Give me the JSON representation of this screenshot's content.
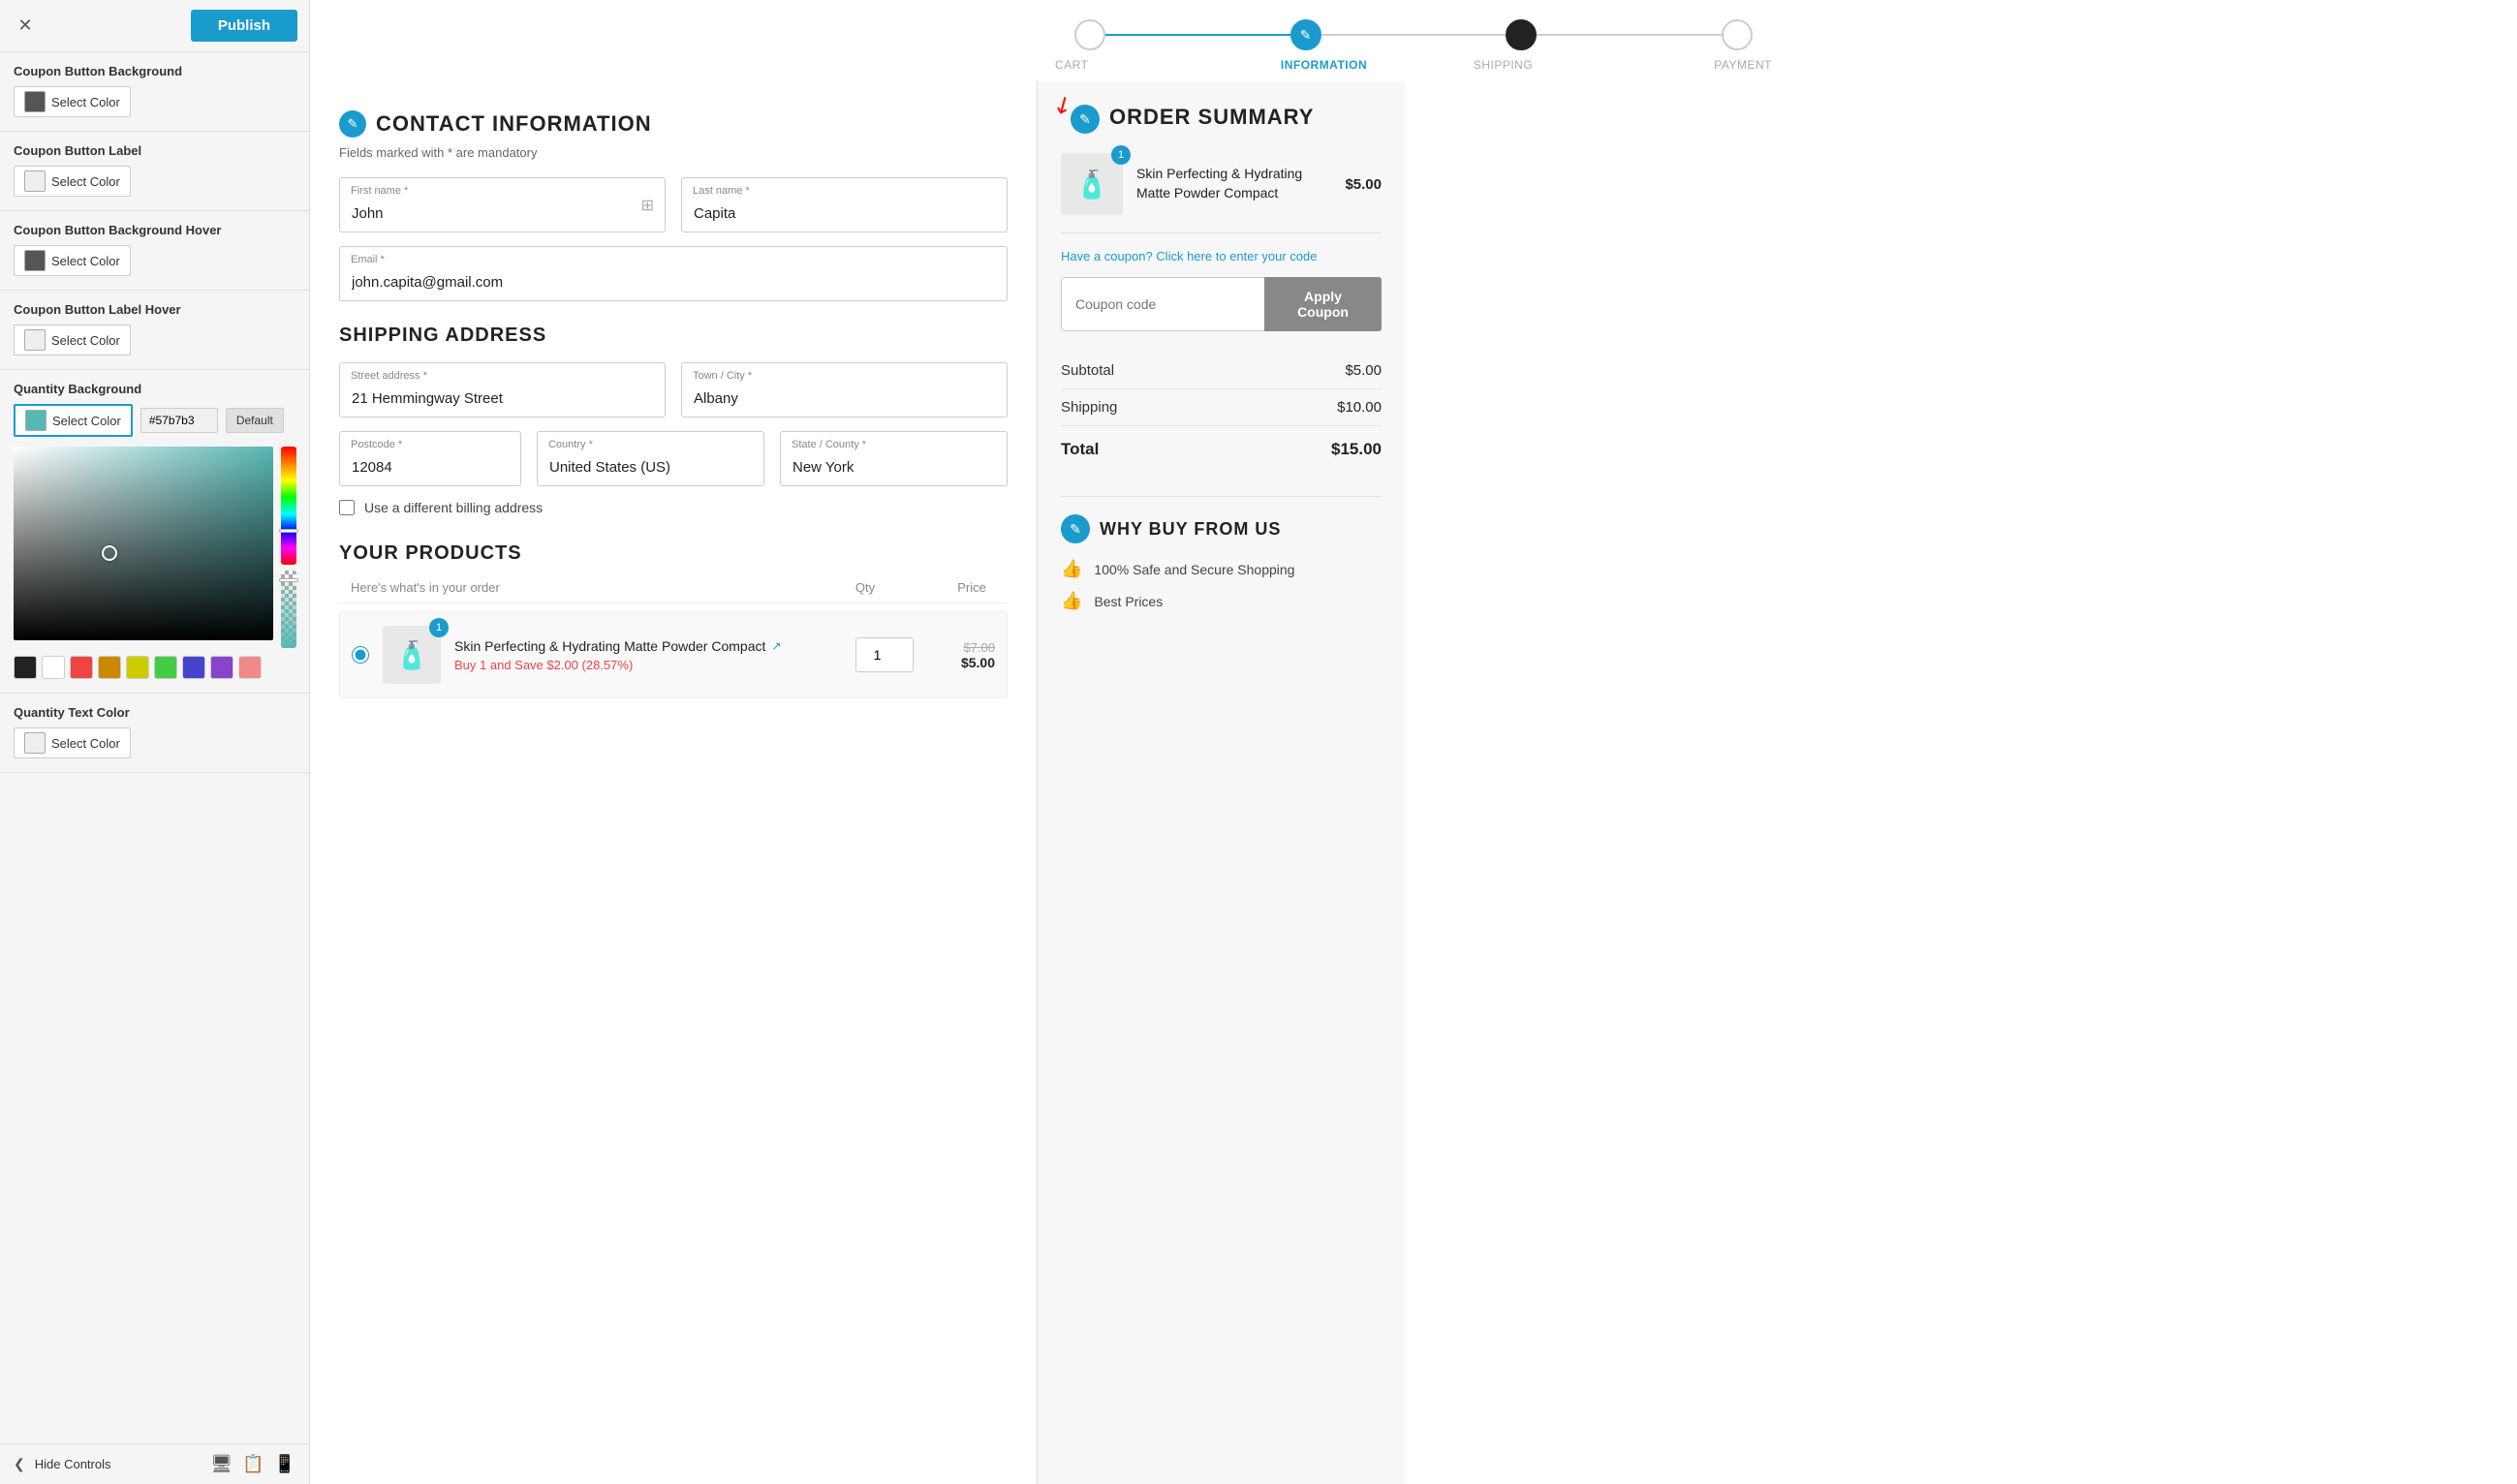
{
  "left_panel": {
    "close_label": "✕",
    "publish_label": "Publish",
    "sections": [
      {
        "id": "coupon_bg",
        "title": "Coupon Button Background",
        "swatch_type": "dark",
        "btn_label": "Select Color"
      },
      {
        "id": "coupon_label",
        "title": "Coupon Button Label",
        "swatch_type": "light",
        "btn_label": "Select Color"
      },
      {
        "id": "coupon_bg_hover",
        "title": "Coupon Button Background Hover",
        "swatch_type": "dark",
        "btn_label": "Select Color"
      },
      {
        "id": "coupon_label_hover",
        "title": "Coupon Button Label Hover",
        "swatch_type": "light",
        "btn_label": "Select Color"
      }
    ],
    "quantity_bg": {
      "title": "Quantity Background",
      "btn_label": "Select Color",
      "hex_value": "#57b7b3",
      "default_label": "Default",
      "active": true
    },
    "quantity_text": {
      "title": "Quantity Text Color",
      "btn_label": "Select Color"
    },
    "swatches": [
      "#222",
      "#fff",
      "#e44",
      "#c80",
      "#cc0",
      "#4c4",
      "#44c",
      "#84c",
      "#e44"
    ],
    "hide_controls_label": "Hide Controls"
  },
  "progress": {
    "steps": [
      "Cart",
      "Information",
      "Shipping",
      "Payment"
    ],
    "active_index": 1
  },
  "contact": {
    "section_title": "CONTACT INFORMATION",
    "badge_icon": "✎",
    "mandatory_note": "Fields marked with * are mandatory",
    "first_name_label": "First name *",
    "first_name_value": "John",
    "last_name_label": "Last name *",
    "last_name_value": "Capita",
    "email_label": "Email *",
    "email_value": "john.capita@gmail.com"
  },
  "shipping": {
    "section_title": "SHIPPING ADDRESS",
    "street_label": "Street address *",
    "street_value": "21 Hemmingway Street",
    "town_label": "Town / City *",
    "town_value": "Albany",
    "postcode_label": "Postcode *",
    "postcode_value": "12084",
    "country_label": "Country *",
    "country_value": "United States (US)",
    "state_label": "State / County *",
    "state_value": "New York",
    "billing_checkbox_label": "Use a different billing address"
  },
  "products": {
    "section_title": "YOUR PRODUCTS",
    "subtitle": "Here's what's in your order",
    "qty_header": "Qty",
    "price_header": "Price",
    "items": [
      {
        "name": "Skin Perfecting & Hydrating Matte Powder Compact",
        "qty": 1,
        "price_old": "$7.00",
        "price_new": "$5.00",
        "discount_text": "Buy 1 and Save $2.00 (28.57%)",
        "badge": "1",
        "emoji": "🧴"
      }
    ]
  },
  "order_summary": {
    "title": "ORDER SUMMARY",
    "badge_icon": "✎",
    "product_name": "Skin Perfecting & Hydrating Matte Powder Compact",
    "product_price": "$5.00",
    "product_badge": "1",
    "product_emoji": "🧴",
    "coupon_link": "Have a coupon? Click here to enter your code",
    "coupon_placeholder": "Coupon code",
    "apply_coupon_label": "Apply Coupon",
    "subtotal_label": "Subtotal",
    "subtotal_value": "$5.00",
    "shipping_label": "Shipping",
    "shipping_value": "$10.00",
    "total_label": "Total",
    "total_value": "$15.00"
  },
  "why_buy": {
    "title": "WHY BUY FROM US",
    "badge_icon": "✎",
    "items": [
      "100% Safe and Secure Shopping",
      "Best Prices"
    ]
  }
}
